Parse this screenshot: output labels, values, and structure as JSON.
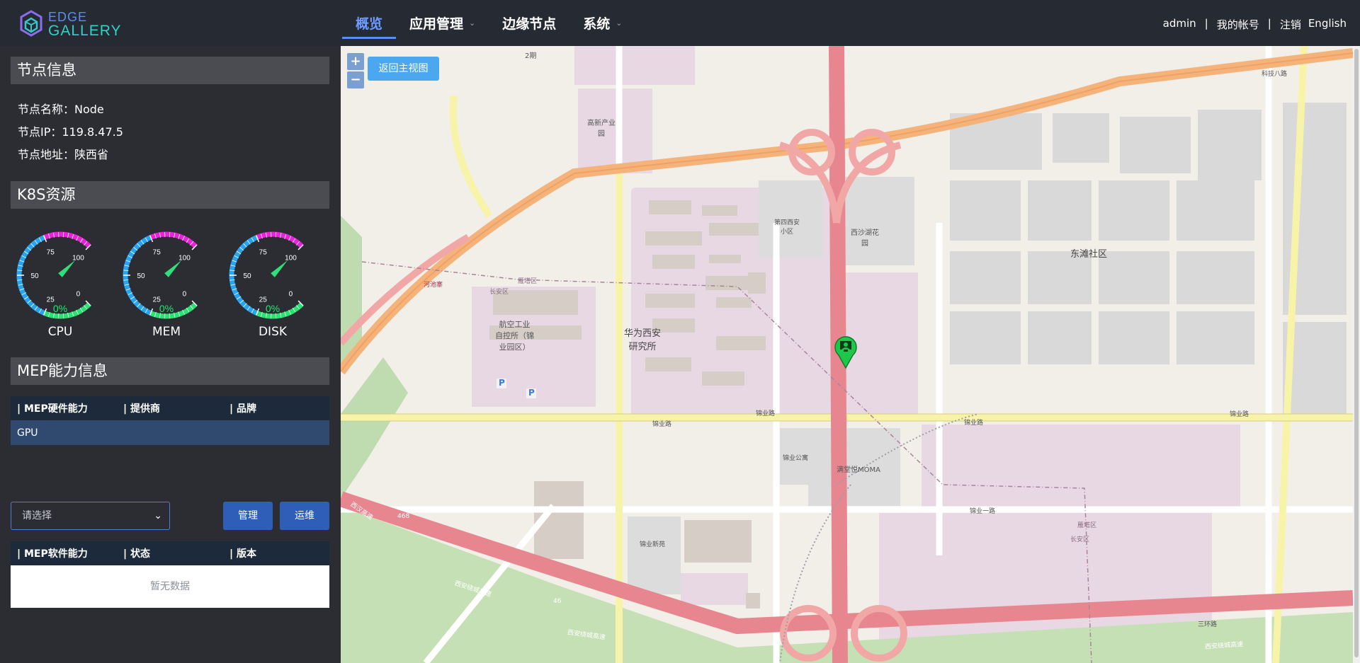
{
  "brand": {
    "line1": "EDGE",
    "line2": "GALLERY"
  },
  "nav": [
    {
      "label": "概览",
      "active": true,
      "dropdown": false
    },
    {
      "label": "应用管理",
      "active": false,
      "dropdown": true
    },
    {
      "label": "边缘节点",
      "active": false,
      "dropdown": false
    },
    {
      "label": "系统",
      "active": false,
      "dropdown": true
    }
  ],
  "user": {
    "name": "admin",
    "account": "我的帐号",
    "logout": "注销",
    "language": "English"
  },
  "node_info": {
    "title": "节点信息",
    "name_label": "节点名称：",
    "name_value": "Node",
    "ip_label": "节点IP：",
    "ip_value": "119.8.47.5",
    "addr_label": "节点地址：",
    "addr_value": "陕西省"
  },
  "k8s": {
    "title": "K8S资源",
    "gauges": [
      {
        "label": "CPU",
        "percent_text": "0%",
        "percent": 0
      },
      {
        "label": "MEM",
        "percent_text": "0%",
        "percent": 0
      },
      {
        "label": "DISK",
        "percent_text": "0%",
        "percent": 0
      }
    ],
    "ticks": [
      "0",
      "25",
      "50",
      "75",
      "100"
    ]
  },
  "mep": {
    "title": "MEP能力信息",
    "hw_headers": [
      "| MEP硬件能力",
      "| 提供商",
      "| 品牌"
    ],
    "hw_rows": [
      [
        "GPU",
        "",
        ""
      ]
    ],
    "select_placeholder": "请选择",
    "manage_button": "管理",
    "ops_button": "运维",
    "sw_headers": [
      "| MEP软件能力",
      "| 状态",
      "| 版本"
    ],
    "sw_empty": "暂无数据"
  },
  "map": {
    "zoom_in": "+",
    "zoom_out": "−",
    "home_button": "返回主视图",
    "labels": {
      "huawei": "华为西安\n研究所",
      "aviation": "航空工业\n自控所（锦\n业园区）",
      "dongtan": "东滩社区",
      "gaoxin": "高新产业\n园",
      "xisha": "西沙湖花\n园",
      "disi": "第四西安\n小区",
      "moma": "满堂悦MOMA",
      "jinye_gongyu": "锦业公寓",
      "jinye_xinyuan": "锦业新苑",
      "jinye_road": "锦业路",
      "jinye_1": "锦业一路",
      "keji8": "科技八路",
      "sanhuan": "三环路",
      "phase2": "2期",
      "heyan": "河池寨",
      "yanta": "雁塔区",
      "changan": "长安区",
      "xianhuan": "西安绕城高速",
      "xihan": "西汉高速",
      "r468": "468",
      "r46": "46",
      "p": "P"
    }
  }
}
